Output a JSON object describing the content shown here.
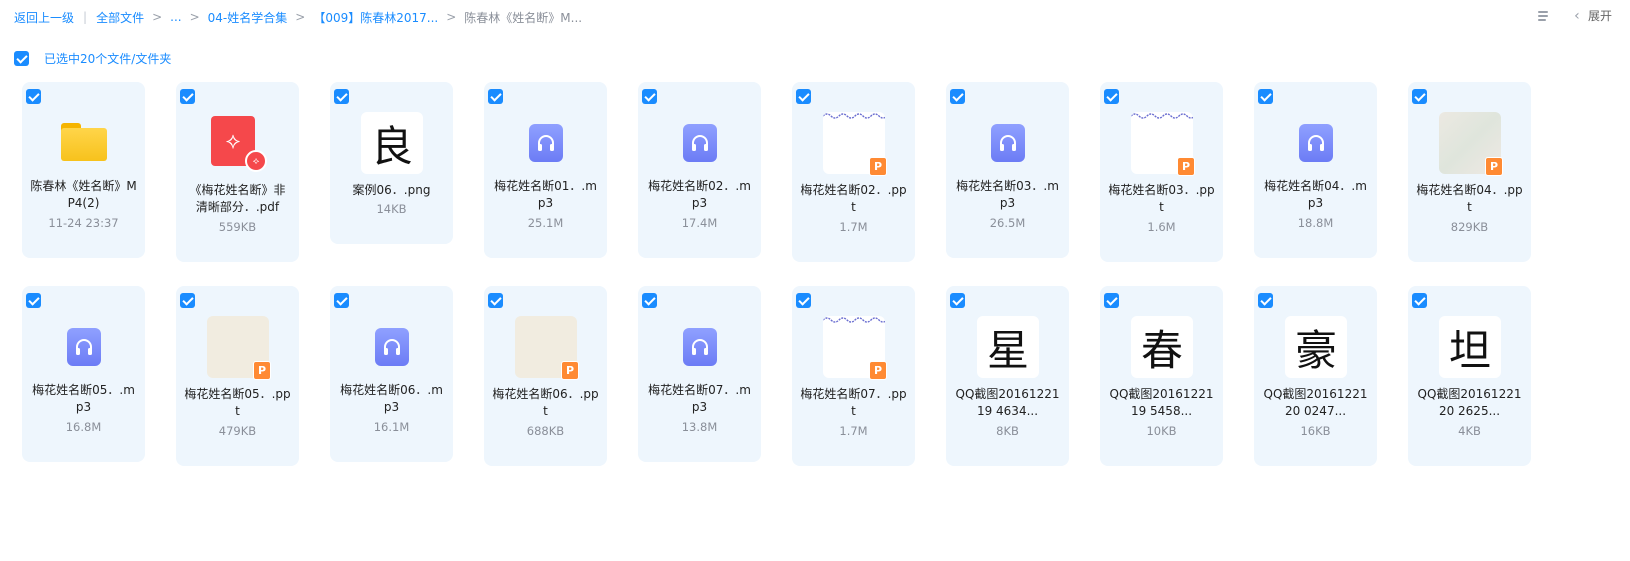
{
  "breadcrumb": {
    "back": "返回上一级",
    "all_files": "全部文件",
    "sep": ">",
    "ellipsis": "...",
    "level1": "04-姓名学合集",
    "level2": "【009】陈春林2017...",
    "current": "陈春林《姓名断》M..."
  },
  "top_actions": {
    "expand": "展开"
  },
  "selection": {
    "label": "已选中20个文件/文件夹"
  },
  "files": [
    {
      "name": "陈春林《姓名断》MP4(2)",
      "meta": "11-24 23:37",
      "type": "folder"
    },
    {
      "name": "《梅花姓名断》非清晰部分．.pdf",
      "meta": "559KB",
      "type": "pdf"
    },
    {
      "name": "案例06．.png",
      "meta": "14KB",
      "type": "image",
      "glyph": "良"
    },
    {
      "name": "梅花姓名断01．.mp3",
      "meta": "25.1M",
      "type": "audio"
    },
    {
      "name": "梅花姓名断02．.mp3",
      "meta": "17.4M",
      "type": "audio"
    },
    {
      "name": "梅花姓名断02．.ppt",
      "meta": "1.7M",
      "type": "ppt-white"
    },
    {
      "name": "梅花姓名断03．.mp3",
      "meta": "26.5M",
      "type": "audio"
    },
    {
      "name": "梅花姓名断03．.ppt",
      "meta": "1.6M",
      "type": "ppt-white"
    },
    {
      "name": "梅花姓名断04．.mp3",
      "meta": "18.8M",
      "type": "audio"
    },
    {
      "name": "梅花姓名断04．.ppt",
      "meta": "829KB",
      "type": "ppt-photo"
    },
    {
      "name": "梅花姓名断05．.mp3",
      "meta": "16.8M",
      "type": "audio"
    },
    {
      "name": "梅花姓名断05．.ppt",
      "meta": "479KB",
      "type": "ppt-beige"
    },
    {
      "name": "梅花姓名断06．.mp3",
      "meta": "16.1M",
      "type": "audio"
    },
    {
      "name": "梅花姓名断06．.ppt",
      "meta": "688KB",
      "type": "ppt-beige"
    },
    {
      "name": "梅花姓名断07．.mp3",
      "meta": "13.8M",
      "type": "audio"
    },
    {
      "name": "梅花姓名断07．.ppt",
      "meta": "1.7M",
      "type": "ppt-white"
    },
    {
      "name": "QQ截图2016122119 4634...",
      "meta": "8KB",
      "type": "image",
      "glyph": "星"
    },
    {
      "name": "QQ截图2016122119 5458...",
      "meta": "10KB",
      "type": "image",
      "glyph": "春"
    },
    {
      "name": "QQ截图2016122120 0247...",
      "meta": "16KB",
      "type": "image",
      "glyph": "豪"
    },
    {
      "name": "QQ截图2016122120 2625...",
      "meta": "4KB",
      "type": "image",
      "glyph": "坦"
    }
  ],
  "icons": {
    "ppt_badge": "P",
    "pdf_symbol": "⟡",
    "pdf_badge": "⟡"
  },
  "colors": {
    "accent": "#1a8cff",
    "card_bg": "#eef6fd",
    "audio": "#7b8af7",
    "ppt_badge": "#ff8a33",
    "pdf": "#f5484b"
  }
}
